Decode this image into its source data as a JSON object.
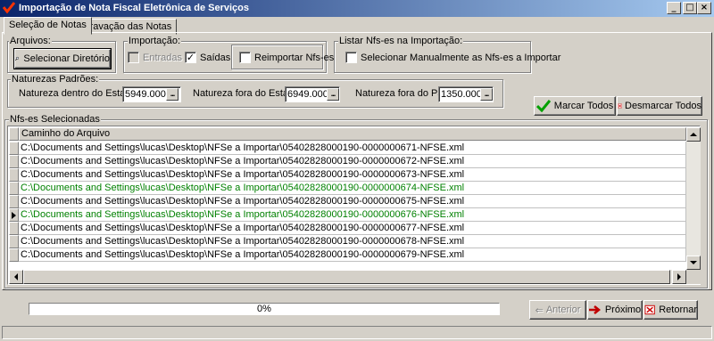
{
  "window": {
    "title": "Importação de Nota Fiscal Eletrônica de Serviços",
    "minimize": "_",
    "maximize": "□",
    "close": "×"
  },
  "tabs": [
    {
      "label": "Seleção de Notas",
      "active": true
    },
    {
      "label": "Gravação das Notas",
      "active": false
    }
  ],
  "arquivos": {
    "group_label": "Arquivos:",
    "button_label": "Selecionar Diretório"
  },
  "importacao": {
    "group_label": "Importação:",
    "entradas": {
      "label": "Entradas",
      "checked": false,
      "enabled": false
    },
    "saidas": {
      "label": "Saídas",
      "checked": true,
      "enabled": true
    },
    "reimportar": {
      "label": "Reimportar Nfs-es",
      "checked": false,
      "enabled": true
    }
  },
  "listar": {
    "group_label": "Listar Nfs-es na Importação:",
    "manual": {
      "label": "Selecionar Manualmente as Nfs-es a Importar",
      "checked": false
    }
  },
  "naturezas": {
    "group_label": "Naturezas Padrões:",
    "dentro": {
      "label": "Natureza dentro do Estado:",
      "value": "5949.000"
    },
    "fora_estado": {
      "label": "Natureza fora do Estado:",
      "value": "6949.000"
    },
    "fora_pais": {
      "label": "Natureza fora do País:",
      "value": "1350.000"
    },
    "ellipsis": "..."
  },
  "actions": {
    "marcar_todos": "Marcar Todos",
    "desmarcar_todos": "Desmarcar Todos"
  },
  "nfses": {
    "group_label": "Nfs-es Selecionadas",
    "column_header": "Caminho do Arquivo",
    "current_row_index": 5,
    "rows": [
      {
        "path": "C:\\Documents and Settings\\lucas\\Desktop\\NFSe a Importar\\05402828000190-0000000671-NFSE.xml",
        "color": "#000000"
      },
      {
        "path": "C:\\Documents and Settings\\lucas\\Desktop\\NFSe a Importar\\05402828000190-0000000672-NFSE.xml",
        "color": "#000000"
      },
      {
        "path": "C:\\Documents and Settings\\lucas\\Desktop\\NFSe a Importar\\05402828000190-0000000673-NFSE.xml",
        "color": "#000000"
      },
      {
        "path": "C:\\Documents and Settings\\lucas\\Desktop\\NFSe a Importar\\05402828000190-0000000674-NFSE.xml",
        "color": "#008000"
      },
      {
        "path": "C:\\Documents and Settings\\lucas\\Desktop\\NFSe a Importar\\05402828000190-0000000675-NFSE.xml",
        "color": "#000000"
      },
      {
        "path": "C:\\Documents and Settings\\lucas\\Desktop\\NFSe a Importar\\05402828000190-0000000676-NFSE.xml",
        "color": "#008000"
      },
      {
        "path": "C:\\Documents and Settings\\lucas\\Desktop\\NFSe a Importar\\05402828000190-0000000677-NFSE.xml",
        "color": "#000000"
      },
      {
        "path": "C:\\Documents and Settings\\lucas\\Desktop\\NFSe a Importar\\05402828000190-0000000678-NFSE.xml",
        "color": "#000000"
      },
      {
        "path": "C:\\Documents and Settings\\lucas\\Desktop\\NFSe a Importar\\05402828000190-0000000679-NFSE.xml",
        "color": "#000000"
      }
    ]
  },
  "progress": {
    "text": "0%",
    "value": 0
  },
  "footer": {
    "anterior": "Anterior",
    "proximo": "Próximo",
    "retornar": "Retornar"
  },
  "colors": {
    "title_gradient_start": "#0a246a",
    "title_gradient_end": "#a6caf0",
    "face": "#d4d0c8",
    "highlight_row": "#008000"
  }
}
